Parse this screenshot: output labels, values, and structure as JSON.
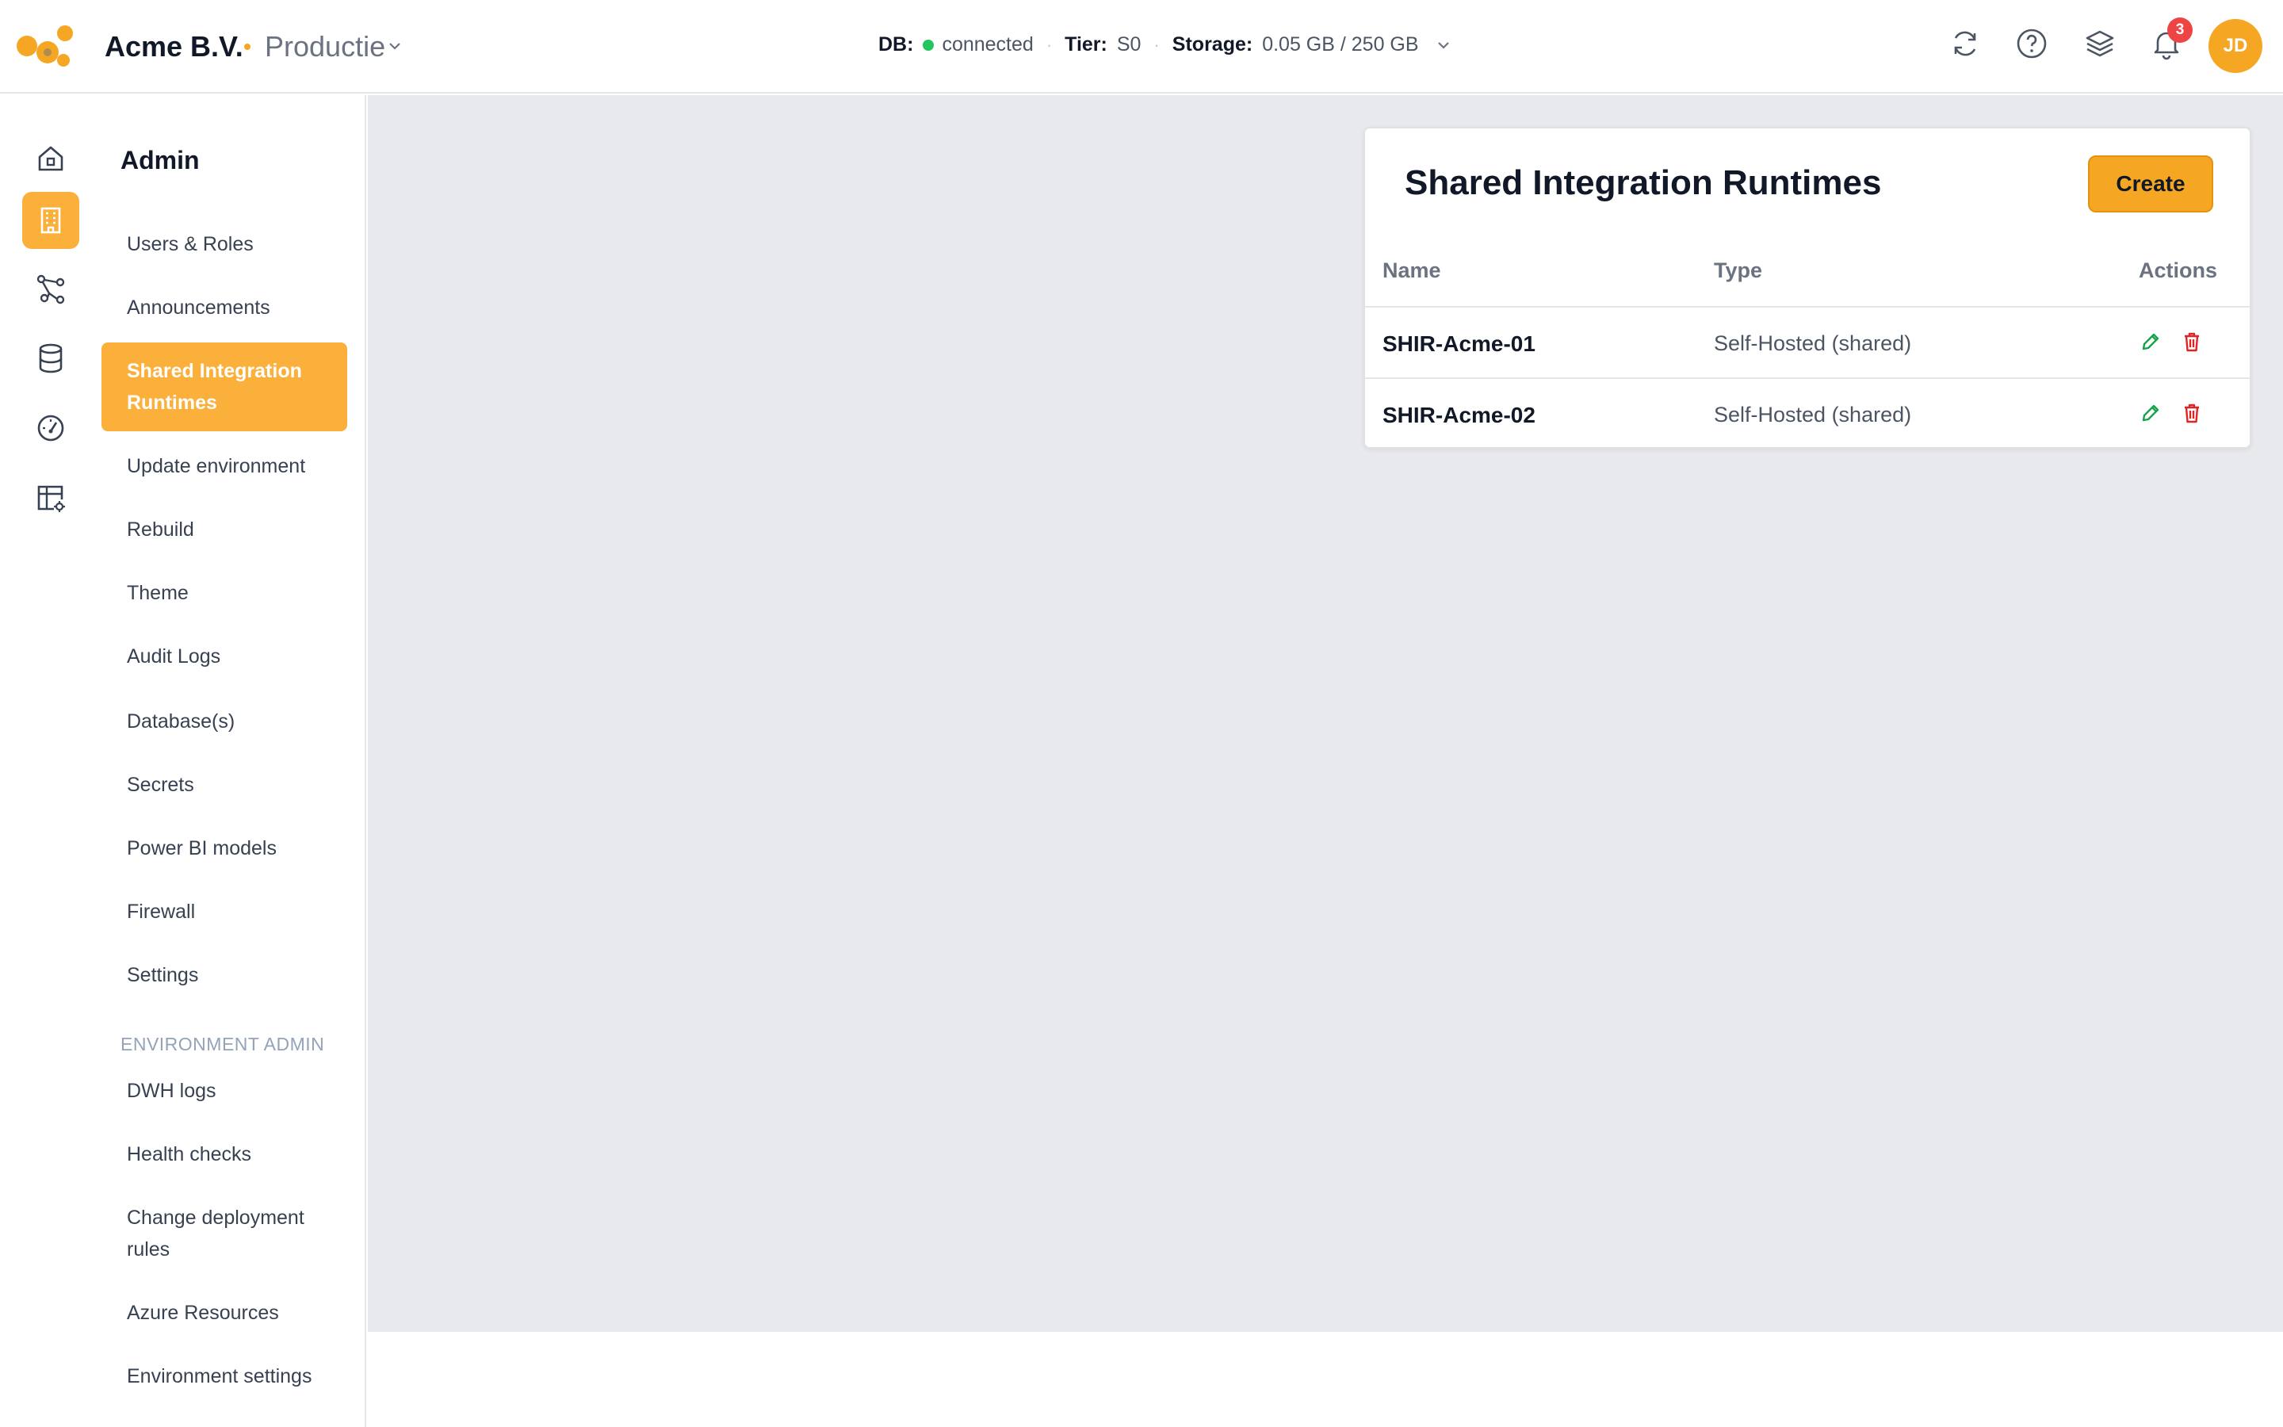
{
  "header": {
    "org_name": "Acme B.V.",
    "environment": "Productie",
    "status": {
      "db_label": "DB:",
      "db_value": "connected",
      "tier_label": "Tier:",
      "tier_value": "S0",
      "storage_label": "Storage:",
      "storage_value": "0.05 GB / 250 GB"
    },
    "notifications_count": "3",
    "avatar_initials": "JD",
    "colors": {
      "accent": "#f5a623",
      "badge": "#ef4444",
      "connected": "#22c55e"
    }
  },
  "rail": {
    "items": [
      "home-icon",
      "building-icon",
      "pipeline-icon",
      "database-icon",
      "gauge-icon",
      "table-settings-icon"
    ],
    "active_index": 1
  },
  "nav": {
    "title": "Admin",
    "items": [
      "Users & Roles",
      "Announcements",
      "Shared Integration Runtimes",
      "Update environment",
      "Rebuild",
      "Theme",
      "Audit Logs",
      "Database(s)",
      "Secrets",
      "Power BI models",
      "Firewall",
      "Settings"
    ],
    "active_item": "Shared Integration Runtimes",
    "section_title": "ENVIRONMENT ADMIN",
    "section_items": [
      "DWH logs",
      "Health checks",
      "Change deployment rules",
      "Azure Resources",
      "Environment settings"
    ]
  },
  "card": {
    "title": "Shared Integration Runtimes",
    "create_label": "Create",
    "columns": [
      "Name",
      "Type",
      "Actions"
    ],
    "rows": [
      {
        "name": "SHIR-Acme-01",
        "type": "Self-Hosted (shared)"
      },
      {
        "name": "SHIR-Acme-02",
        "type": "Self-Hosted (shared)"
      }
    ]
  }
}
